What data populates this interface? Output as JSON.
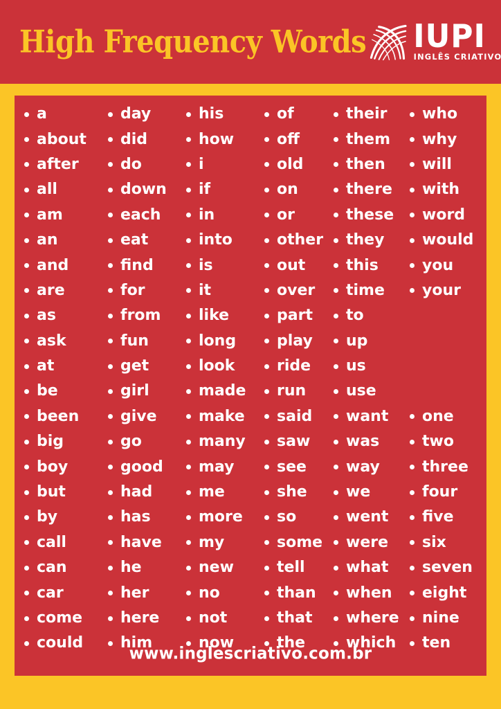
{
  "header": {
    "title": "High Frequency Words",
    "brand_name": "IUPI",
    "brand_tagline": "INGLÊS CRIATIVO",
    "brand_mark_icon": "swirl-ball-icon"
  },
  "colors": {
    "red": "#cb3239",
    "yellow": "#fbc526",
    "white": "#ffffff"
  },
  "footer": {
    "url": "www.inglescriativo.com.br"
  },
  "word_columns": [
    {
      "index": 1,
      "words": [
        "a",
        "about",
        "after",
        "all",
        "am",
        "an",
        "and",
        "are",
        "as",
        "ask",
        "at",
        "be",
        "been",
        "big",
        "boy",
        "but",
        "by",
        "call",
        "can",
        "car",
        "come",
        "could"
      ]
    },
    {
      "index": 2,
      "words": [
        "day",
        "did",
        "do",
        "down",
        "each",
        "eat",
        "find",
        "for",
        "from",
        "fun",
        "get",
        "girl",
        "give",
        "go",
        "good",
        "had",
        "has",
        "have",
        "he",
        "her",
        "here",
        "him"
      ]
    },
    {
      "index": 3,
      "words": [
        "his",
        "how",
        "i",
        "if",
        "in",
        "into",
        "is",
        "it",
        "like",
        "long",
        "look",
        "made",
        "make",
        "many",
        "may",
        "me",
        "more",
        "my",
        "new",
        "no",
        "not",
        "now"
      ]
    },
    {
      "index": 4,
      "words": [
        "of",
        "off",
        "old",
        "on",
        "or",
        "other",
        "out",
        "over",
        "part",
        "play",
        "ride",
        "run",
        "said",
        "saw",
        "see",
        "she",
        "so",
        "some",
        "tell",
        "than",
        "that",
        "the"
      ]
    },
    {
      "index": 5,
      "words": [
        "their",
        "them",
        "then",
        "there",
        "these",
        "they",
        "this",
        "time",
        "to",
        "up",
        "us",
        "use",
        "want",
        "was",
        "way",
        "we",
        "went",
        "were",
        "what",
        "when",
        "where",
        "which"
      ]
    },
    {
      "index": 6,
      "words": [
        "who",
        "why",
        "will",
        "with",
        "word",
        "would",
        "you",
        "your",
        "",
        "",
        "",
        "",
        "one",
        "two",
        "three",
        "four",
        "five",
        "six",
        "seven",
        "eight",
        "nine",
        "ten"
      ]
    }
  ]
}
